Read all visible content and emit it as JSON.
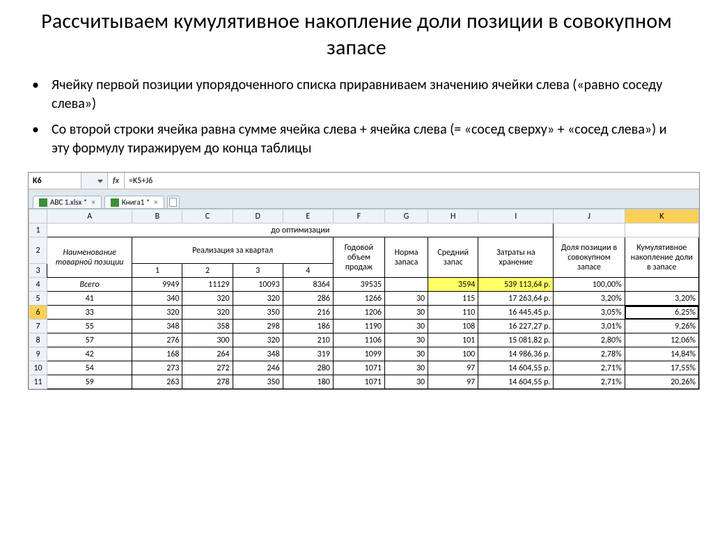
{
  "title": "Рассчитываем кумулятивное накопление доли позиции в совокупном запасе",
  "bullets": [
    "Ячейку первой позиции упорядоченного списка приравниваем значению ячейки слева («равно соседу слева»)",
    "Со второй строки ячейка равна сумме ячейка слева + ячейка слева (= «сосед сверху» + «сосед слева») и эту формулу тиражируем до конца таблицы"
  ],
  "namebox": "K6",
  "fx_label": "fx",
  "formula": "=K5+J6",
  "tabs": {
    "t1": "ABC 1.xlsx *",
    "t2": "Книга1 *"
  },
  "cols": [
    "A",
    "B",
    "C",
    "D",
    "E",
    "F",
    "G",
    "H",
    "I",
    "J",
    "K"
  ],
  "row1_label": "до оптимизации",
  "head": {
    "name": "Наименование товарной позиции",
    "real": "Реализация за квартал",
    "q1": "1",
    "q2": "2",
    "q3": "3",
    "q4": "4",
    "vol": "Годовой объем продаж",
    "norm": "Норма запаса",
    "avg": "Средний запас",
    "cost": "Затраты на хранение",
    "share": "Доля позиции в совокупном запасе",
    "cum": "Кумулятивное накопление доли в запасе"
  },
  "chart_data": {
    "type": "table",
    "columns": [
      "Наименование товарной позиции",
      "1",
      "2",
      "3",
      "4",
      "Годовой объем продаж",
      "Норма запаса",
      "Средний запас",
      "Затраты на хранение",
      "Доля позиции в совокупном запасе",
      "Кумулятивное накопление доли в запасе"
    ],
    "rows": [
      {
        "row": 4,
        "a": "Всего",
        "b": "9949",
        "c": "11129",
        "d": "10093",
        "e": "8364",
        "f": "39535",
        "g": "",
        "h": "3594",
        "i": "539 113,64 р.",
        "j": "100,00%",
        "k": ""
      },
      {
        "row": 5,
        "a": "41",
        "b": "340",
        "c": "320",
        "d": "320",
        "e": "286",
        "f": "1266",
        "g": "30",
        "h": "115",
        "i": "17 263,64 р.",
        "j": "3,20%",
        "k": "3,20%"
      },
      {
        "row": 6,
        "a": "33",
        "b": "320",
        "c": "320",
        "d": "350",
        "e": "216",
        "f": "1206",
        "g": "30",
        "h": "110",
        "i": "16 445,45 р.",
        "j": "3,05%",
        "k": "6,25%"
      },
      {
        "row": 7,
        "a": "55",
        "b": "348",
        "c": "358",
        "d": "298",
        "e": "186",
        "f": "1190",
        "g": "30",
        "h": "108",
        "i": "16 227,27 р.",
        "j": "3,01%",
        "k": "9,26%"
      },
      {
        "row": 8,
        "a": "57",
        "b": "276",
        "c": "300",
        "d": "320",
        "e": "210",
        "f": "1106",
        "g": "30",
        "h": "101",
        "i": "15 081,82 р.",
        "j": "2,80%",
        "k": "12,06%"
      },
      {
        "row": 9,
        "a": "42",
        "b": "168",
        "c": "264",
        "d": "348",
        "e": "319",
        "f": "1099",
        "g": "30",
        "h": "100",
        "i": "14 986,36 р.",
        "j": "2,78%",
        "k": "14,84%"
      },
      {
        "row": 10,
        "a": "54",
        "b": "273",
        "c": "272",
        "d": "246",
        "e": "280",
        "f": "1071",
        "g": "30",
        "h": "97",
        "i": "14 604,55 р.",
        "j": "2,71%",
        "k": "17,55%"
      },
      {
        "row": 11,
        "a": "59",
        "b": "263",
        "c": "278",
        "d": "350",
        "e": "180",
        "f": "1071",
        "g": "30",
        "h": "97",
        "i": "14 604,55 р.",
        "j": "2,71%",
        "k": "20,26%"
      }
    ]
  }
}
